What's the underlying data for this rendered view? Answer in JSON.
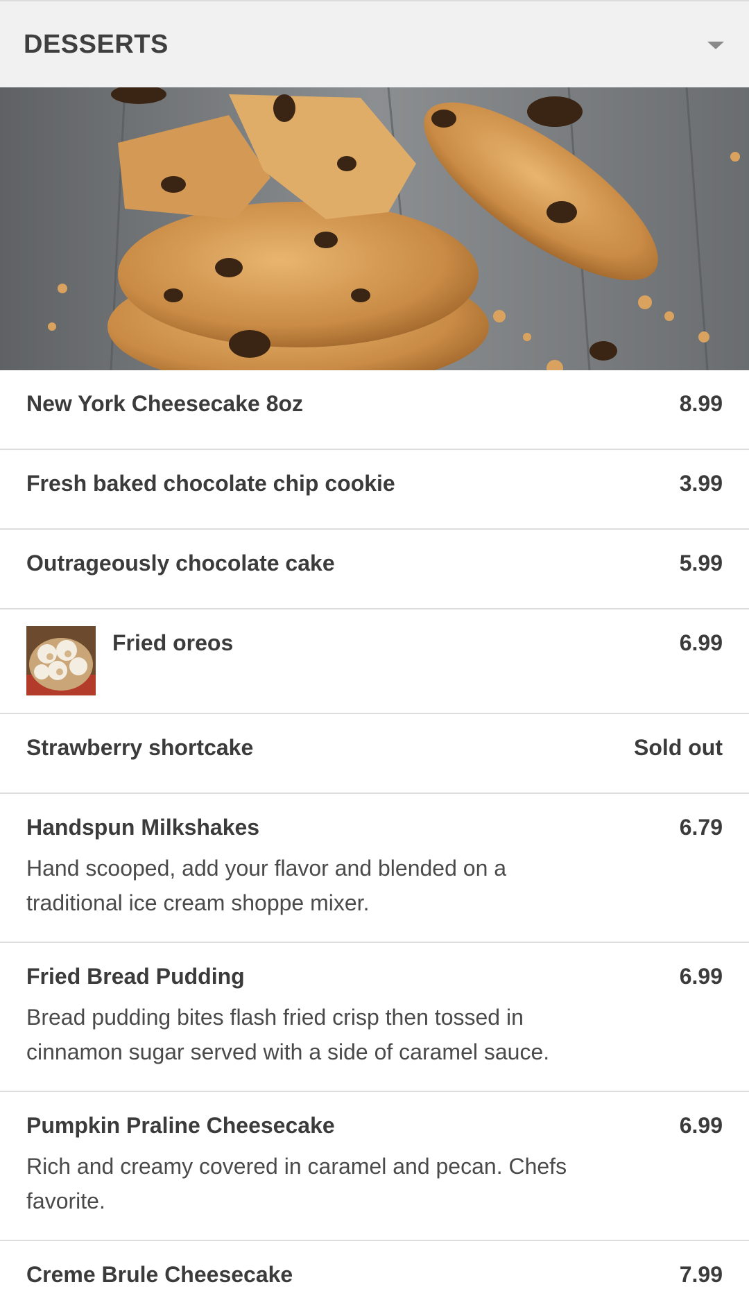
{
  "section": {
    "title": "DESSERTS",
    "toggle_icon": "caret-down-icon"
  },
  "hero_image": {
    "subject": "chocolate chip cookies"
  },
  "items": [
    {
      "name": "New York Cheesecake 8oz",
      "price": "8.99",
      "description": ""
    },
    {
      "name": "Fresh baked chocolate chip cookie",
      "price": "3.99",
      "description": ""
    },
    {
      "name": "Outrageously chocolate cake",
      "price": "5.99",
      "description": ""
    },
    {
      "name": "Fried oreos",
      "price": "6.99",
      "description": "",
      "thumbnail": "fried oreos"
    },
    {
      "name": "Strawberry shortcake",
      "price": "Sold out",
      "description": ""
    },
    {
      "name": "Handspun Milkshakes",
      "price": "6.79",
      "description": "Hand scooped, add your flavor and blended on a traditional ice cream shoppe mixer."
    },
    {
      "name": "Fried Bread Pudding",
      "price": "6.99",
      "description": "Bread pudding bites flash fried crisp then tossed in cinnamon sugar served with a side of caramel sauce."
    },
    {
      "name": "Pumpkin Praline Cheesecake",
      "price": "6.99",
      "description": "Rich and creamy covered in caramel and pecan. Chefs favorite."
    },
    {
      "name": "Creme Brule Cheesecake",
      "price": "7.99",
      "description": ""
    }
  ]
}
